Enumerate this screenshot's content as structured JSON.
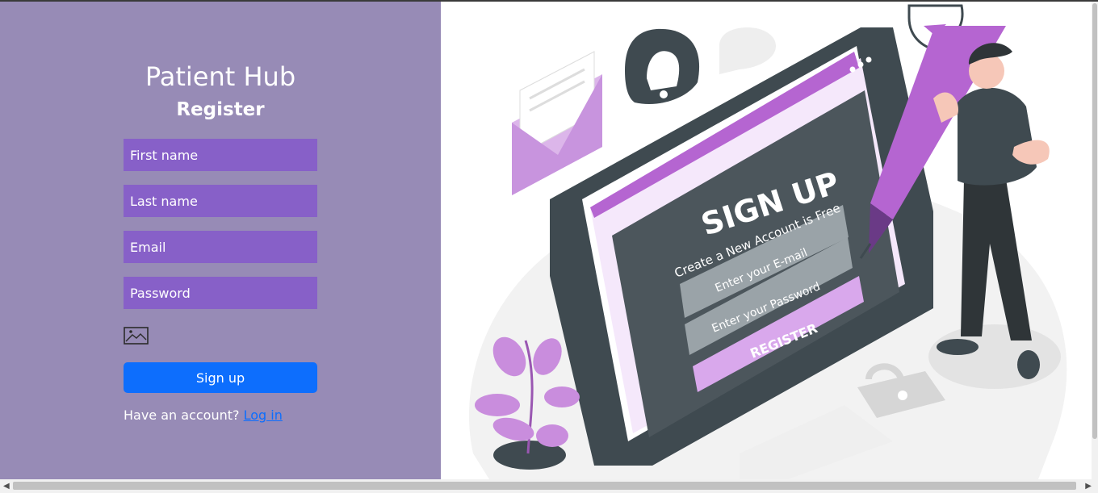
{
  "brand": {
    "app_title": "Patient Hub",
    "form_title": "Register"
  },
  "form": {
    "first_name_placeholder": "First name",
    "last_name_placeholder": "Last name",
    "email_placeholder": "Email",
    "password_placeholder": "Password",
    "upload_icon": "image-icon",
    "submit_label": "Sign up"
  },
  "footer": {
    "prompt": "Have an account?",
    "login_link": "Log in"
  },
  "illustration": {
    "heading": "SIGN UP",
    "tagline": "Create a New Account is Free",
    "email_placeholder": "Enter your E-mail",
    "password_placeholder": "Enter your Password",
    "button_label": "REGISTER"
  },
  "colors": {
    "left_panel": "#978bb6",
    "input_bg": "#8760c8",
    "primary": "#0d6efd",
    "accent_purple": "#b565d1"
  }
}
